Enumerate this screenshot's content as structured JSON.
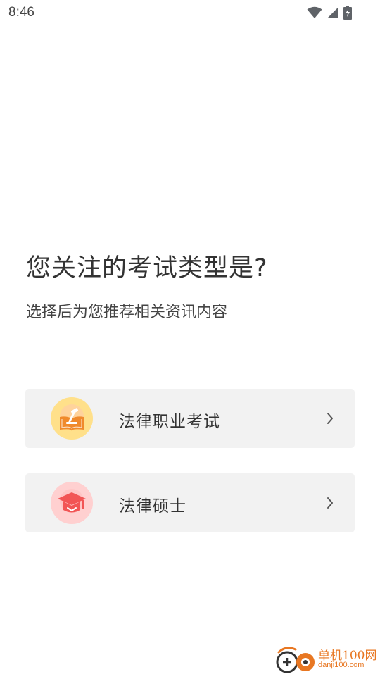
{
  "status_bar": {
    "time": "8:46",
    "icons": [
      "wifi-icon",
      "signal-icon",
      "battery-charging-icon"
    ]
  },
  "main": {
    "title": "您关注的考试类型是?",
    "subtitle": "选择后为您推荐相关资讯内容",
    "options": [
      {
        "label": "法律职业考试",
        "icon": "gavel-book-icon",
        "icon_bg": "#ffe08a",
        "icon_color": "#f08a2c"
      },
      {
        "label": "法律硕士",
        "icon": "graduation-cap-icon",
        "icon_bg": "#ffd0d0",
        "icon_color": "#f25555"
      }
    ]
  },
  "watermark": {
    "name": "单机100网",
    "url": "danji100.com",
    "color": "#e87722"
  }
}
